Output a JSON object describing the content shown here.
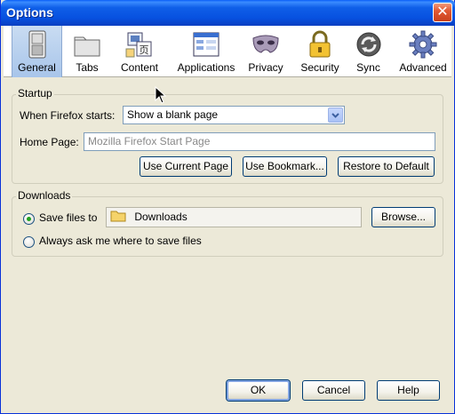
{
  "window": {
    "title": "Options"
  },
  "tabs": [
    {
      "label": "General",
      "icon": "switch-icon",
      "selected": true
    },
    {
      "label": "Tabs",
      "icon": "folder-tabs-icon"
    },
    {
      "label": "Content",
      "icon": "content-icon"
    },
    {
      "label": "Applications",
      "icon": "applications-icon"
    },
    {
      "label": "Privacy",
      "icon": "mask-icon"
    },
    {
      "label": "Security",
      "icon": "padlock-icon"
    },
    {
      "label": "Sync",
      "icon": "sync-icon"
    },
    {
      "label": "Advanced",
      "icon": "gear-icon"
    }
  ],
  "startup": {
    "group_label": "Startup",
    "when_starts_label": "When Firefox starts:",
    "when_starts_value": "Show a blank page",
    "home_page_label": "Home Page:",
    "home_page_placeholder": "Mozilla Firefox Start Page",
    "use_current_label": "Use Current Page",
    "use_bookmark_label": "Use Bookmark...",
    "restore_default_label": "Restore to Default"
  },
  "downloads": {
    "group_label": "Downloads",
    "save_to_label": "Save files to",
    "save_to_folder": "Downloads",
    "browse_label": "Browse...",
    "always_ask_label": "Always ask me where to save files",
    "selected_option": "save_to"
  },
  "footer": {
    "ok_label": "OK",
    "cancel_label": "Cancel",
    "help_label": "Help"
  },
  "colors": {
    "title_bar": "#0a5ef8",
    "selected_tab": "#a8c5ea",
    "dialog_bg": "#ece9d8"
  }
}
